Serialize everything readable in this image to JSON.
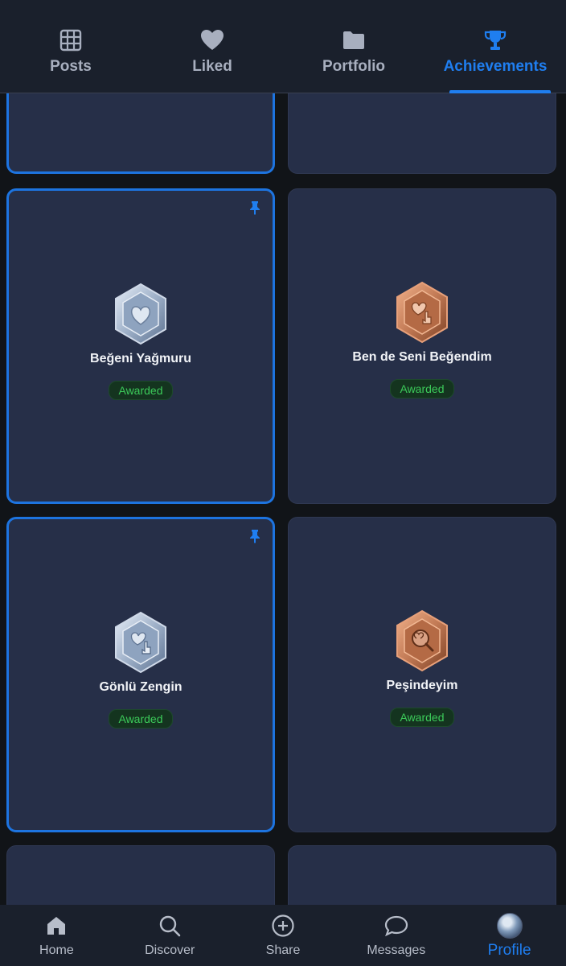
{
  "colors": {
    "accent": "#1f7ef0",
    "card_bg": "#262f48",
    "status_green": "#3ccb5a",
    "silver": "#b9c7db",
    "bronze": "#c27a55"
  },
  "top_tabs": [
    {
      "label": "Posts",
      "icon": "grid-icon"
    },
    {
      "label": "Liked",
      "icon": "heart-icon"
    },
    {
      "label": "Portfolio",
      "icon": "folder-icon"
    },
    {
      "label": "Achievements",
      "icon": "trophy-icon",
      "active": true
    }
  ],
  "achievements": [
    {
      "title": "Beğeni Yağmuru",
      "status": "Awarded",
      "tier": "silver",
      "pinned": true,
      "icon": "heart-badge-icon"
    },
    {
      "title": "Ben de Seni Beğendim",
      "status": "Awarded",
      "tier": "bronze",
      "pinned": false,
      "icon": "heart-hand-badge-icon"
    },
    {
      "title": "Gönlü Zengin",
      "status": "Awarded",
      "tier": "silver",
      "pinned": true,
      "icon": "heart-hand-badge-icon"
    },
    {
      "title": "Peşindeyim",
      "status": "Awarded",
      "tier": "bronze",
      "pinned": false,
      "icon": "magnifier-badge-icon"
    }
  ],
  "bottom_nav": [
    {
      "label": "Home",
      "icon": "home-icon"
    },
    {
      "label": "Discover",
      "icon": "search-icon"
    },
    {
      "label": "Share",
      "icon": "plus-circle-icon"
    },
    {
      "label": "Messages",
      "icon": "chat-bubble-icon"
    },
    {
      "label": "Profile",
      "icon": "avatar",
      "active": true
    }
  ]
}
